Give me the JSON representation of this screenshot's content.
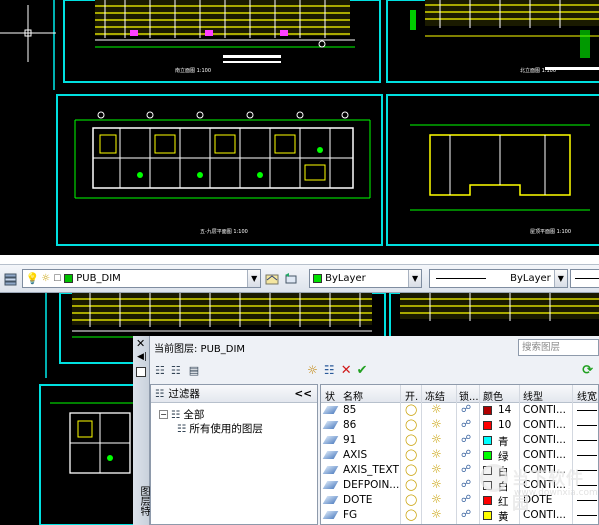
{
  "drawing_top": {
    "label_left": "南立面图 1:100",
    "label_right": "北立面图 1:100",
    "label_bottom_left": "五-九层平面图 1:100",
    "label_bottom_right": "屋顶平面图 1:100"
  },
  "toolbar": {
    "layer_combo_value": "PUB_DIM",
    "layer_color": "#00c000",
    "color_combo_value": "ByLayer",
    "linetype_combo_value": "ByLayer"
  },
  "layer_manager": {
    "current_layer_label": "当前图层: PUB_DIM",
    "search_placeholder": "搜索图层",
    "side_label": "图层特",
    "filters_title": "过滤器",
    "collapse_label": "<<",
    "tree": {
      "all_label": "全部",
      "used_label": "所有使用的图层"
    },
    "columns": [
      "状",
      "名称",
      "开.",
      "冻结",
      "锁...",
      "颜色",
      "线型",
      "线宽"
    ],
    "layers": [
      {
        "name": "85",
        "color_name": "14",
        "color": "#b00000",
        "linetype": "CONTI..."
      },
      {
        "name": "86",
        "color_name": "10",
        "color": "#ff0000",
        "linetype": "CONTI..."
      },
      {
        "name": "91",
        "color_name": "青",
        "color": "#00ffff",
        "linetype": "CONTI..."
      },
      {
        "name": "AXIS",
        "color_name": "绿",
        "color": "#00ff00",
        "linetype": "CONTI..."
      },
      {
        "name": "AXIS_TEXT",
        "color_name": "白",
        "color": "#ffffff",
        "linetype": "CONTI..."
      },
      {
        "name": "DEFPOIN...",
        "color_name": "白",
        "color": "#ffffff",
        "linetype": "CONTI..."
      },
      {
        "name": "DOTE",
        "color_name": "红",
        "color": "#ff0000",
        "linetype": "DOTE"
      },
      {
        "name": "FG",
        "color_name": "黄",
        "color": "#ffff00",
        "linetype": "CONTI..."
      }
    ]
  },
  "watermark": {
    "brand": "当下软件园",
    "url": "www.downxia.com"
  }
}
